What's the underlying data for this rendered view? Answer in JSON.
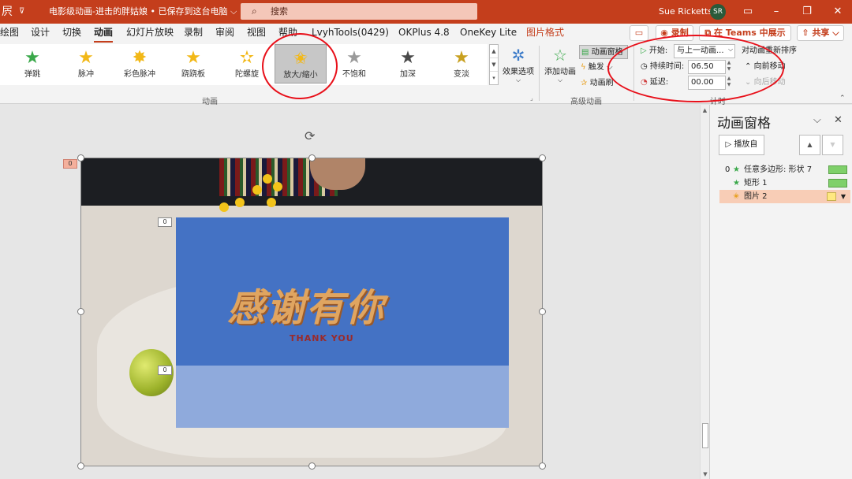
{
  "titlebar": {
    "doc_title": "电影级动画-进击的胖姑娘 • 已保存到这台电脑",
    "search_placeholder": "搜索",
    "user_name": "Sue Ricketts",
    "user_initials": "SR",
    "title_icon": "屄",
    "qa_arrow": "⊽"
  },
  "tabs": [
    "绘图",
    "设计",
    "切换",
    "动画",
    "幻灯片放映",
    "录制",
    "审阅",
    "视图",
    "帮助",
    "LvyhTools(0429)",
    "OKPlus 4.8",
    "OneKey Lite",
    "图片格式"
  ],
  "tab_buttons": {
    "record": "录制",
    "teams": "在 Teams 中展示",
    "share": "共享"
  },
  "animations": [
    {
      "label": "弹跳",
      "color": "#3aa84a"
    },
    {
      "label": "脉冲",
      "color": "#f2b817"
    },
    {
      "label": "彩色脉冲",
      "color": "#f2b817"
    },
    {
      "label": "跷跷板",
      "color": "#f2b817"
    },
    {
      "label": "陀螺旋",
      "color": "#f2b817"
    },
    {
      "label": "放大/缩小",
      "color": "#f2b817"
    },
    {
      "label": "不饱和",
      "color": "#9a9a9a"
    },
    {
      "label": "加深",
      "color": "#4a4a4a"
    },
    {
      "label": "变淡",
      "color": "#c8a020"
    }
  ],
  "ribbon": {
    "group_animation": "动画",
    "effect_options": "效果选项",
    "add_animation": "添加动画",
    "animation_pane": "动画窗格",
    "trigger": "触发",
    "animation_painter": "动画刷",
    "group_advanced": "高级动画",
    "start_label": "开始:",
    "start_value": "与上一动画...",
    "duration_label": "持续时间:",
    "duration_value": "06.50",
    "delay_label": "延迟:",
    "delay_value": "00.00",
    "reorder_title": "对动画重新排序",
    "move_earlier": "向前移动",
    "move_later": "向后移动",
    "group_timing": "计时"
  },
  "slide": {
    "headline": "感谢有你",
    "subline": "THANK YOU",
    "tags": [
      "0",
      "0",
      "0"
    ]
  },
  "pane": {
    "title": "动画窗格",
    "play_from": "播放自",
    "items": [
      {
        "index": "0",
        "label": "任意多边形: 形状 7"
      },
      {
        "index": "",
        "label": "矩形 1"
      },
      {
        "index": "",
        "label": "图片 2"
      }
    ]
  }
}
